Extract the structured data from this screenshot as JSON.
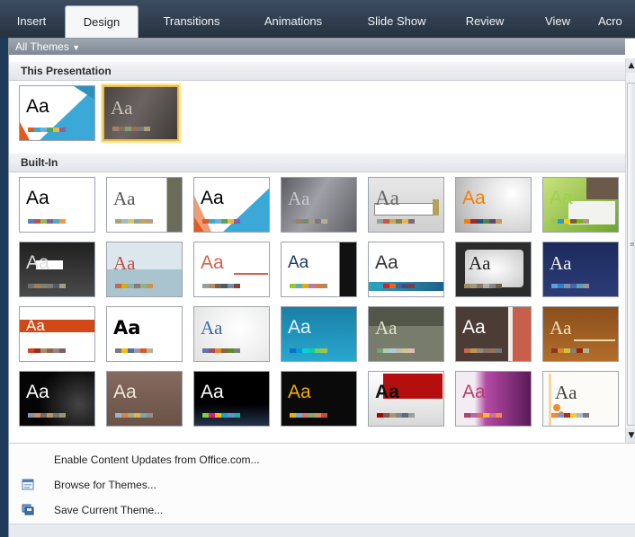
{
  "ribbon": {
    "tabs": [
      "Insert",
      "Design",
      "Transitions",
      "Animations",
      "Slide Show",
      "Review",
      "View",
      "Acro"
    ],
    "active": "Design"
  },
  "gallery": {
    "filter_label": "All Themes",
    "section_this": "This Presentation",
    "section_builtin": "Built-In",
    "thumb_text": "Aa"
  },
  "menu": {
    "enable_updates": "Enable Content Updates from Office.com...",
    "browse_themes": "Browse for Themes...",
    "save_theme": "Save Current Theme..."
  },
  "colors": {
    "accent_selected": "#e9b949",
    "ribbon_bg": "#2f3d4e",
    "filter_bar": "#8a929c"
  },
  "icons": [
    "dropdown-triangle-icon",
    "scroll-up-icon",
    "scroll-down-icon",
    "browse-folder-icon",
    "save-theme-icon"
  ]
}
